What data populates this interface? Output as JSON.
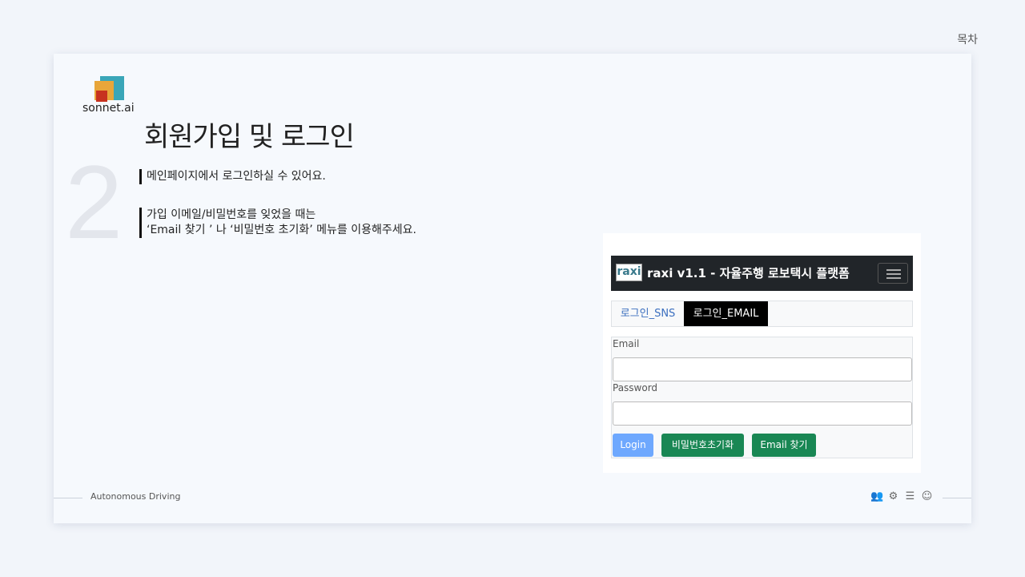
{
  "top": {
    "toc_label": "목차"
  },
  "logo": {
    "text": "sonnet.ai"
  },
  "slide": {
    "title": "회원가입 및 로그인",
    "section_number": "2",
    "block1": {
      "line1": "메인페이지에서 로그인하실 수 있어요."
    },
    "block2": {
      "line1": "가입 이메일/비밀번호를 잊었을 때는",
      "line2": "‘Email 찾기 ’ 나 ‘비밀번호 초기화’ 메뉴를 이용해주세요."
    }
  },
  "screenshot": {
    "nav_logo": "raxi",
    "nav_title": "raxi v1.1 - 자율주행 로보택시 플랫폼",
    "tabs": [
      {
        "label": "로그인_SNS"
      },
      {
        "label": "로그인_EMAIL"
      }
    ],
    "email_label": "Email",
    "password_label": "Password",
    "buttons": {
      "login": "Login",
      "reset": "비밀번호초기화",
      "find": "Email 찾기"
    }
  },
  "footer": {
    "text": "Autonomous Driving",
    "icons": [
      "users-icon",
      "gear-icon",
      "database-icon",
      "user-circle-icon"
    ]
  }
}
